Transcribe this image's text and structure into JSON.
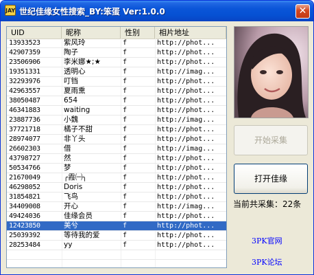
{
  "window": {
    "title": "世纪佳缘女性搜索_BY:笨蛋 Ver:1.0.0",
    "icon_text": "JAY",
    "close_symbol": "✕"
  },
  "table": {
    "columns": [
      "UID",
      "昵称",
      "性别",
      "相片地址"
    ],
    "selected_index": 22,
    "rows": [
      [
        "13933523",
        "紫风玲",
        "f",
        "http://phot..."
      ],
      [
        "42907359",
        "陶子",
        "f",
        "http://phot..."
      ],
      [
        "23506906",
        "李米娜★;★",
        "f",
        "http://phot..."
      ],
      [
        "19351331",
        "透明心",
        "f",
        "http://imag..."
      ],
      [
        "32293976",
        "叮铛",
        "f",
        "http://phot..."
      ],
      [
        "42963557",
        "夏雨熏",
        "f",
        "http://phot..."
      ],
      [
        "38050487",
        "654",
        "f",
        "http://phot..."
      ],
      [
        "46341883",
        "waiting",
        "f",
        "http://phot..."
      ],
      [
        "23887736",
        "小魏",
        "f",
        "http://imag..."
      ],
      [
        "37721718",
        "橘子不甜",
        "f",
        "http://phot..."
      ],
      [
        "28974077",
        "非丫头",
        "f",
        "http://phot..."
      ],
      [
        "26602303",
        "借",
        "f",
        "http://imag..."
      ],
      [
        "43798727",
        "然",
        "f",
        "http://phot..."
      ],
      [
        "50534766",
        "梦",
        "f",
        "http://phot..."
      ],
      [
        "21670049",
        "╭霞㈠╮",
        "f",
        "http://phot..."
      ],
      [
        "46298052",
        "Doris",
        "f",
        "http://phot..."
      ],
      [
        "31854821",
        "飞鸟",
        "f",
        "http://phot..."
      ],
      [
        "34409008",
        "开心",
        "f",
        "http://imag..."
      ],
      [
        "49424036",
        "佳缘会员",
        "f",
        "http://phot..."
      ],
      [
        "12423850",
        "美兮",
        "f",
        "http://phot..."
      ],
      [
        "25039392",
        "等待我的爱",
        "f",
        "http://phot..."
      ],
      [
        "28253484",
        "yy",
        "f",
        "http://phot..."
      ]
    ]
  },
  "buttons": {
    "start": "开始采集",
    "open": "打开佳缘"
  },
  "status": "当前共采集：22条",
  "links": {
    "official": "3PK官网",
    "forum": "3PK论坛"
  },
  "colors": {
    "selection": "#316ac5",
    "titlebar": "#0a55d8",
    "link": "#0000ff"
  }
}
